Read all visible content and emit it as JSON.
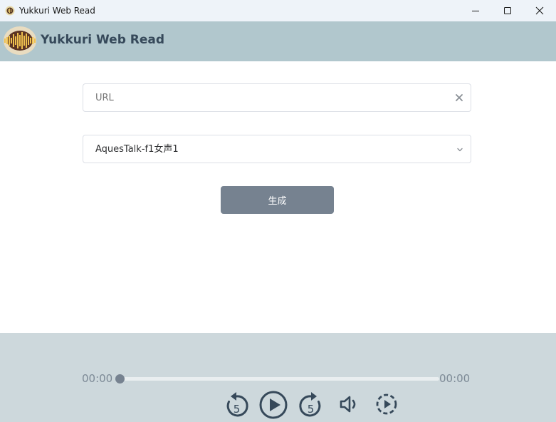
{
  "window": {
    "title": "Yukkuri Web Read",
    "minimize_icon": "minimize-icon",
    "maximize_icon": "maximize-icon",
    "close_icon": "close-icon"
  },
  "header": {
    "app_name": "Yukkuri Web Read",
    "logo_icon": "sound-wave-logo",
    "colors": {
      "header_bg": "#b1c7cd",
      "title": "#36495a"
    }
  },
  "form": {
    "url_input": {
      "placeholder": "URL",
      "value": "",
      "clear_icon": "clear-icon"
    },
    "voice_select": {
      "selected": "AquesTalk-f1女声1",
      "chevron_icon": "chevron-down-icon"
    },
    "generate_button": {
      "label": "生成",
      "color": "#768290"
    }
  },
  "player": {
    "current_time": "00:00",
    "total_time": "00:00",
    "progress": 0,
    "controls": {
      "rewind": {
        "icon": "rewind-5-icon",
        "label": "5"
      },
      "play": {
        "icon": "play-icon"
      },
      "forward": {
        "icon": "forward-5-icon",
        "label": "5"
      },
      "volume": {
        "icon": "volume-icon"
      },
      "speed": {
        "icon": "playback-speed-icon"
      }
    },
    "colors": {
      "bg": "#cdd8dc",
      "control": "#36495a"
    }
  }
}
